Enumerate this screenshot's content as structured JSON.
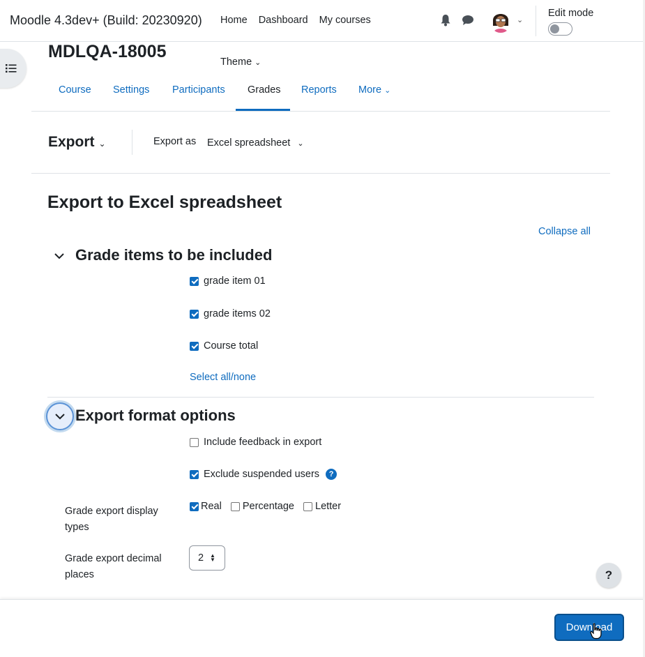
{
  "navbar": {
    "brand": "Moodle 4.3dev+ (Build: 20230920)",
    "items": [
      "Home",
      "Dashboard",
      "My courses"
    ],
    "edit_mode_label": "Edit mode"
  },
  "course": {
    "title": "MDLQA-18005",
    "theme_menu": "Theme",
    "tabs": [
      "Course",
      "Settings",
      "Participants",
      "Grades",
      "Reports",
      "More"
    ],
    "active_tab": "Grades"
  },
  "tertiary": {
    "menu": "Export",
    "export_as_label": "Export as",
    "export_as_value": "Excel spreadsheet"
  },
  "main": {
    "heading": "Export to Excel spreadsheet",
    "collapse_all": "Collapse all",
    "grade_items": {
      "title": "Grade items to be included",
      "items": [
        {
          "label": "grade item 01",
          "checked": true
        },
        {
          "label": "grade items 02",
          "checked": true
        },
        {
          "label": "Course total",
          "checked": true
        }
      ],
      "select_all": "Select all/none"
    },
    "format_options": {
      "title": "Export format options",
      "include_feedback": "Include feedback in export",
      "exclude_suspended": "Exclude suspended users",
      "display_types_label": "Grade export display types",
      "display_types": [
        {
          "label": "Real",
          "checked": true
        },
        {
          "label": "Percentage",
          "checked": false
        },
        {
          "label": "Letter",
          "checked": false
        }
      ],
      "decimal_label": "Grade export decimal places",
      "decimal_value": "2"
    }
  },
  "footer": {
    "download": "Download",
    "help": "?"
  }
}
